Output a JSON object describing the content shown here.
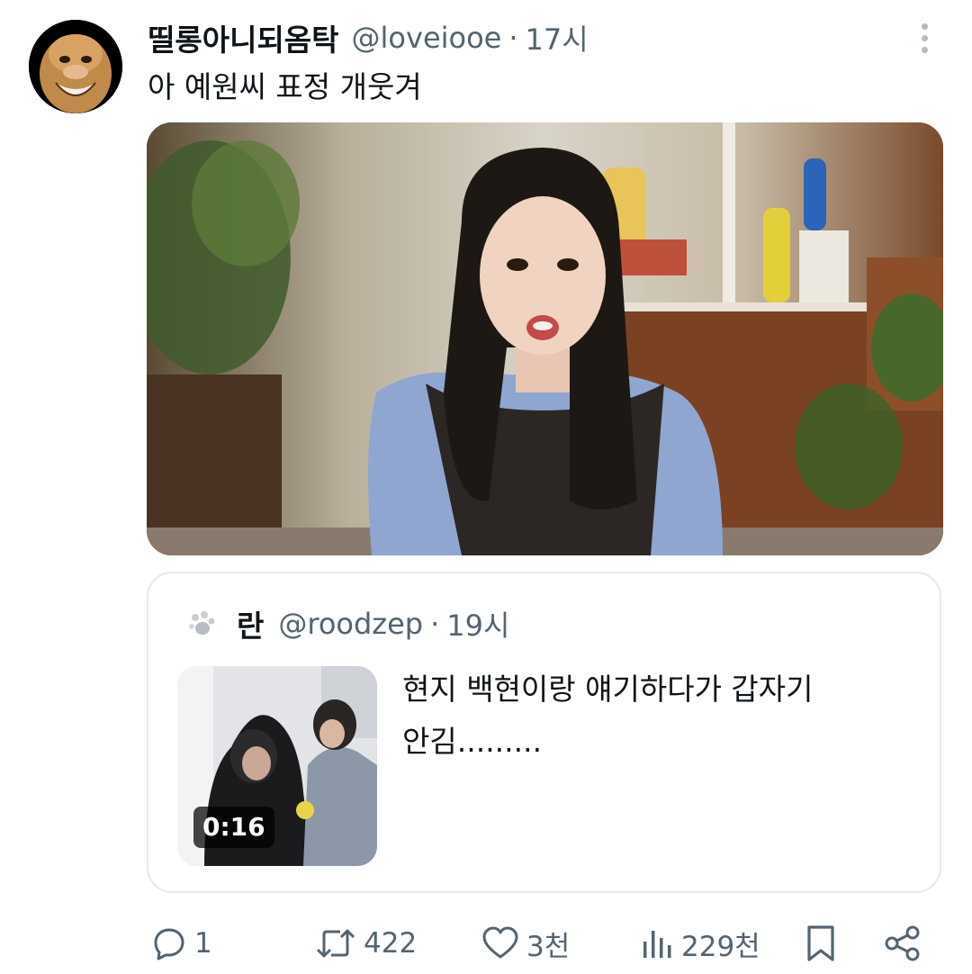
{
  "tweet": {
    "display_name": "띨롱아니되옴탁",
    "handle": "@loveiooe",
    "separator": "·",
    "time": "17시",
    "text": "아 예원씨 표정 개웃겨",
    "avatar_icon": "monkey-face-avatar",
    "media_description_icon": "photo"
  },
  "quote": {
    "display_name": "란",
    "handle": "@roodzep",
    "separator": "·",
    "time": "19시",
    "text_line1": "현지 백현이랑 얘기하다가 갑자기",
    "text_line2": "안김.........",
    "video_duration": "0:16"
  },
  "actions": {
    "reply_count": "1",
    "retweet_count": "422",
    "like_count": "3천",
    "views_count": "229천"
  },
  "colors": {
    "primary_text": "#0f1419",
    "secondary_text": "#536471",
    "border": "#e7e9ec"
  }
}
